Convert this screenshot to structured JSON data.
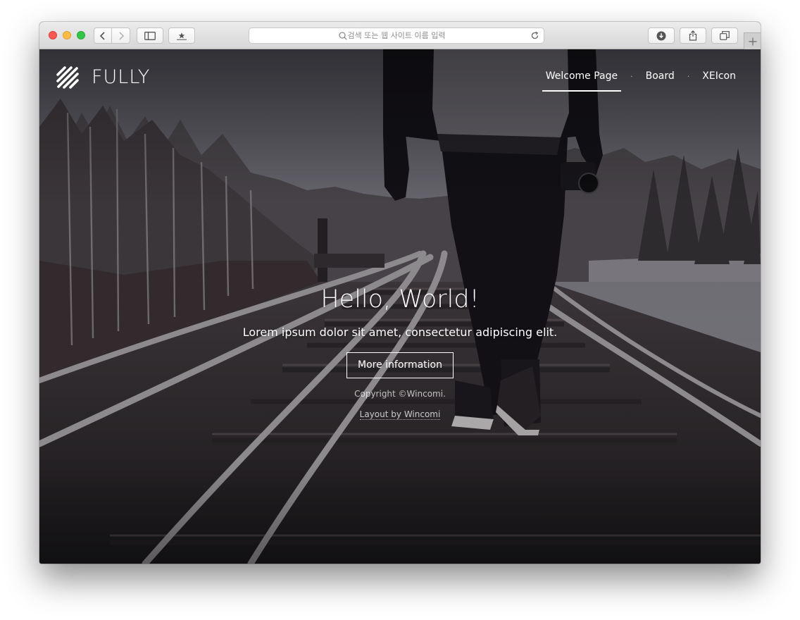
{
  "browser": {
    "address_placeholder": "검색 또는 웹 사이트 이름 입력",
    "icons": [
      "back-icon",
      "forward-icon",
      "sidebar-icon",
      "bookmarks-icon",
      "search-icon",
      "reload-icon",
      "download-icon",
      "share-icon",
      "tabs-icon",
      "new-tab-icon"
    ]
  },
  "site": {
    "brand": "FULLY",
    "nav": [
      {
        "label": "Welcome Page",
        "active": true
      },
      {
        "label": "Board",
        "active": false
      },
      {
        "label": "XEIcon",
        "active": false
      }
    ],
    "nav_separator": "·"
  },
  "hero": {
    "title": "Hello, World!",
    "subtitle": "Lorem ipsum dolor sit amet, consectetur adipiscing elit.",
    "button_label": "More information",
    "copyright": "Copyright ©Wincomi.",
    "layout_prefix": "Layout by",
    "layout_link": "Wincomi"
  },
  "colors": {
    "close": "#fc5753",
    "minimize": "#fdbc40",
    "zoom": "#33c748",
    "hero_text": "#ffffff"
  }
}
